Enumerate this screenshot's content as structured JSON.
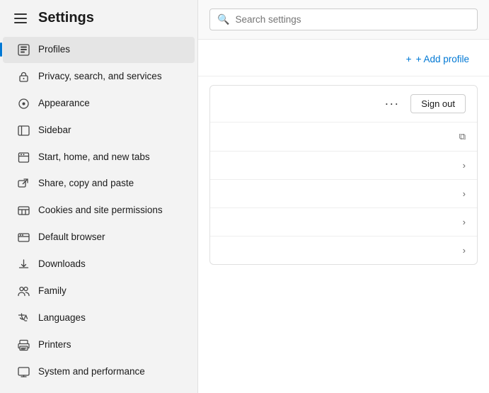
{
  "sidebar": {
    "title": "Settings",
    "items": [
      {
        "id": "profiles",
        "label": "Profiles",
        "active": true,
        "icon": "profiles-icon"
      },
      {
        "id": "privacy",
        "label": "Privacy, search, and services",
        "active": false,
        "icon": "privacy-icon"
      },
      {
        "id": "appearance",
        "label": "Appearance",
        "active": false,
        "icon": "appearance-icon"
      },
      {
        "id": "sidebar",
        "label": "Sidebar",
        "active": false,
        "icon": "sidebar-icon"
      },
      {
        "id": "start-home",
        "label": "Start, home, and new tabs",
        "active": false,
        "icon": "home-icon"
      },
      {
        "id": "share",
        "label": "Share, copy and paste",
        "active": false,
        "icon": "share-icon"
      },
      {
        "id": "cookies",
        "label": "Cookies and site permissions",
        "active": false,
        "icon": "cookies-icon"
      },
      {
        "id": "default-browser",
        "label": "Default browser",
        "active": false,
        "icon": "browser-icon"
      },
      {
        "id": "downloads",
        "label": "Downloads",
        "active": false,
        "icon": "downloads-icon"
      },
      {
        "id": "family",
        "label": "Family",
        "active": false,
        "icon": "family-icon"
      },
      {
        "id": "languages",
        "label": "Languages",
        "active": false,
        "icon": "languages-icon"
      },
      {
        "id": "printers",
        "label": "Printers",
        "active": false,
        "icon": "printers-icon"
      },
      {
        "id": "system",
        "label": "System and performance",
        "active": false,
        "icon": "system-icon"
      }
    ]
  },
  "header": {
    "search_placeholder": "Search settings"
  },
  "main": {
    "add_profile_label": "+ Add profile",
    "sign_out_label": "Sign out",
    "rows": [
      {
        "type": "external"
      },
      {
        "type": "chevron"
      },
      {
        "type": "chevron"
      },
      {
        "type": "chevron"
      },
      {
        "type": "chevron"
      }
    ]
  }
}
